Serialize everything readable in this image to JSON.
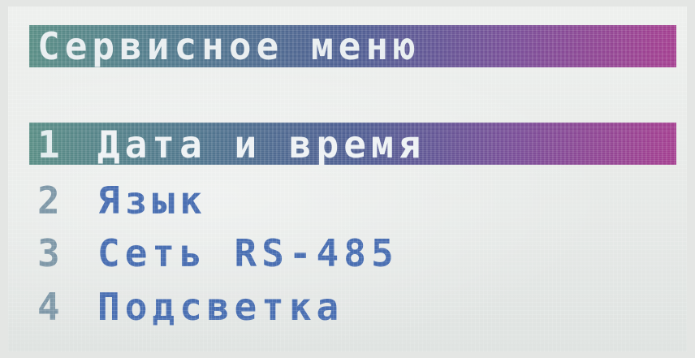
{
  "screen": {
    "title": "Сервисное меню"
  },
  "menu": {
    "selected_index": 0,
    "items": [
      {
        "number": "1",
        "label": "Дата и время"
      },
      {
        "number": "2",
        "label": "Язык"
      },
      {
        "number": "3",
        "label": "Сеть RS-485"
      },
      {
        "number": "4",
        "label": "Подсветка"
      }
    ]
  },
  "colors": {
    "bar_gradient_start": "#5a8e86",
    "bar_gradient_end": "#a43f90",
    "menu_text": "#4a6fb2",
    "menu_number": "#7f98a8",
    "highlight_text": "#eef2f4"
  }
}
